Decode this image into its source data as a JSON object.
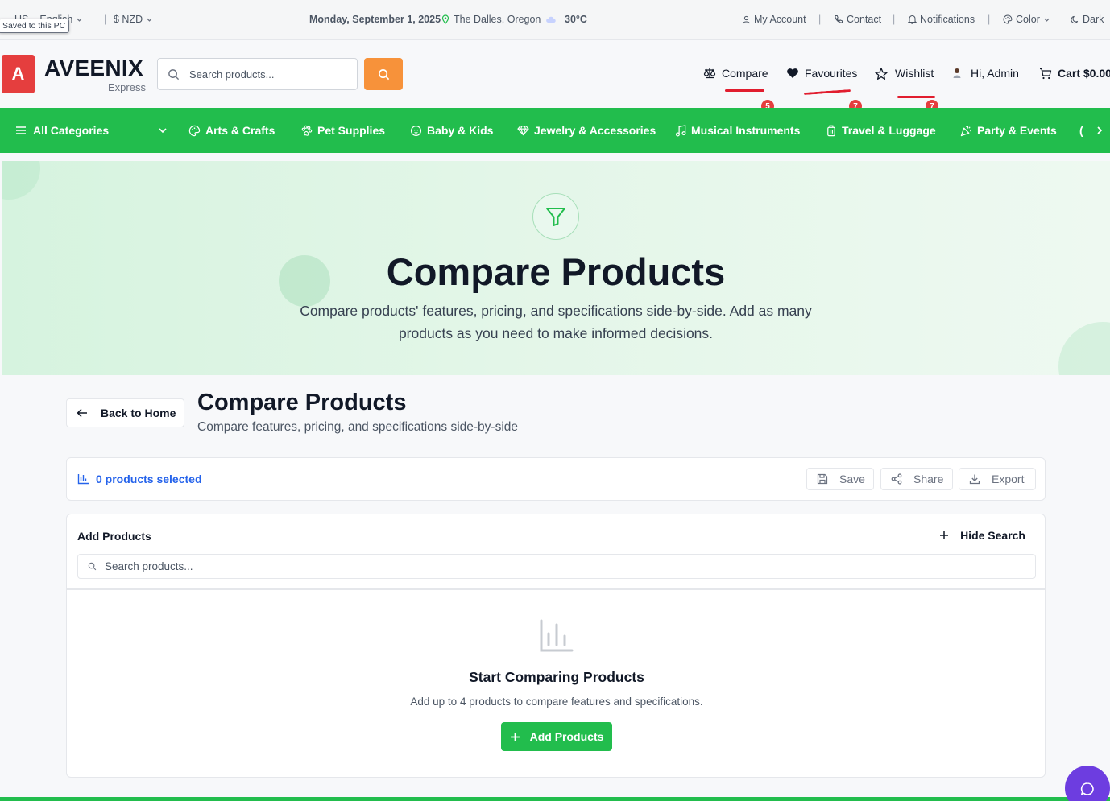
{
  "topbar": {
    "language": "English",
    "language_partial": "sh",
    "currency": "$ NZD",
    "date": "Monday, September 1, 2025",
    "location": "The Dalles, Oregon",
    "temperature": "30°C",
    "my_account": "My Account",
    "contact": "Contact",
    "notifications": "Notifications",
    "color": "Color",
    "theme": "Dark",
    "separator": "|",
    "tooltip": "Saved to this PC"
  },
  "header": {
    "logo_letter": "A",
    "brand": "AVEENIX",
    "brand_sub": "Express",
    "search_placeholder": "Search products...",
    "compare": "Compare",
    "compare_count": "5",
    "favourites": "Favourites",
    "favourites_count": "7",
    "wishlist": "Wishlist",
    "wishlist_count": "7",
    "user": "Hi, Admin",
    "cart": "Cart $0.00"
  },
  "categories": {
    "all": "All Categories",
    "items": [
      "Arts & Crafts",
      "Pet Supplies",
      "Baby & Kids",
      "Jewelry & Accessories",
      "Musical Instruments",
      "Travel & Luggage",
      "Party & Events"
    ]
  },
  "hero": {
    "title": "Compare Products",
    "subtitle": "Compare products' features, pricing, and specifications side-by-side. Add as many products as you need to make informed decisions."
  },
  "page": {
    "back": "Back to Home",
    "title": "Compare Products",
    "subtitle": "Compare features, pricing, and specifications side-by-side"
  },
  "selection": {
    "count": "0 products selected",
    "save": "Save",
    "share": "Share",
    "export": "Export"
  },
  "add_panel": {
    "title": "Add Products",
    "hide_search": "Hide Search",
    "search_placeholder": "Search products..."
  },
  "empty": {
    "title": "Start Comparing Products",
    "subtitle": "Add up to 4 products to compare features and specifications.",
    "button": "Add Products"
  },
  "colors": {
    "brand_green": "#22bd4d",
    "accent_orange": "#f7923a",
    "badge_red": "#e53e3e",
    "link_blue": "#2563eb",
    "chat_purple": "#6d3de0"
  }
}
